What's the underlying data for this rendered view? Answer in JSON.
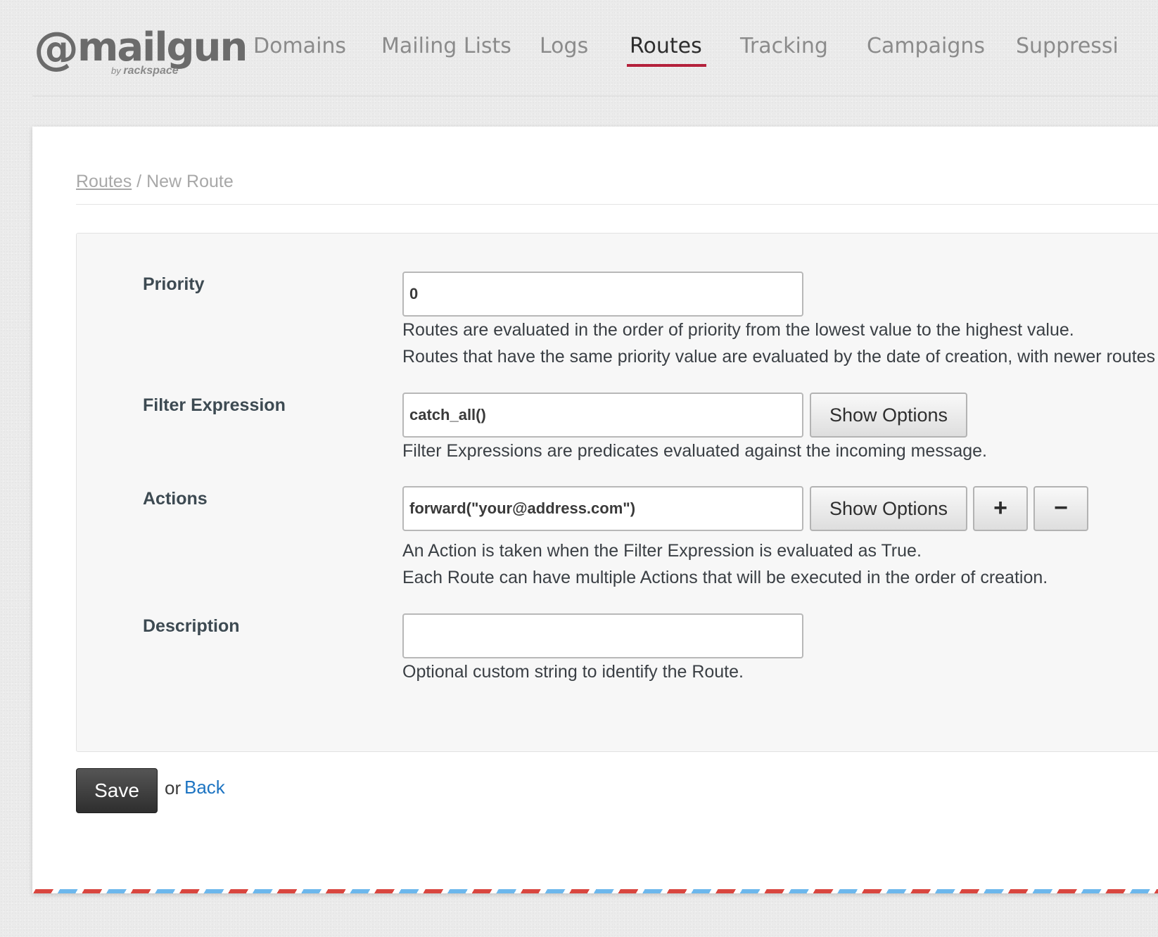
{
  "brand": {
    "logo_at": "@",
    "logo_word": "mailgun",
    "logo_by": "by",
    "logo_company": "rackspace"
  },
  "nav": {
    "items": [
      {
        "label": "Domains"
      },
      {
        "label": "Mailing Lists"
      },
      {
        "label": "Logs"
      },
      {
        "label": "Routes",
        "active": true
      },
      {
        "label": "Tracking"
      },
      {
        "label": "Campaigns"
      },
      {
        "label": "Suppressi"
      }
    ]
  },
  "breadcrumb": {
    "parent": "Routes",
    "separator": " / ",
    "current": "New Route"
  },
  "form": {
    "priority": {
      "label": "Priority",
      "value": "0",
      "help_line1": "Routes are evaluated in the order of priority from the lowest value to the highest value.",
      "help_line2": "Routes that have the same priority value are evaluated by the date of creation, with newer routes"
    },
    "filter": {
      "label": "Filter Expression",
      "value": "catch_all()",
      "options_label": "Show Options",
      "help_line1": "Filter Expressions are predicates evaluated against the incoming message."
    },
    "actions": {
      "label": "Actions",
      "value": "forward(\"your@address.com\")",
      "options_label": "Show Options",
      "add_label": "+",
      "remove_label": "−",
      "help_line1": "An Action is taken when the Filter Expression is evaluated as True.",
      "help_line2": "Each Route can have multiple Actions that will be executed in the order of creation."
    },
    "description": {
      "label": "Description",
      "value": "",
      "help_line1": "Optional custom string to identify the Route."
    }
  },
  "footer": {
    "save_label": "Save",
    "or_text": "or",
    "back_label": "Back"
  },
  "colors": {
    "accent": "#b4213b",
    "link": "#1d74c2",
    "airmail_red": "#d9463f",
    "airmail_blue": "#6cb7ec"
  }
}
